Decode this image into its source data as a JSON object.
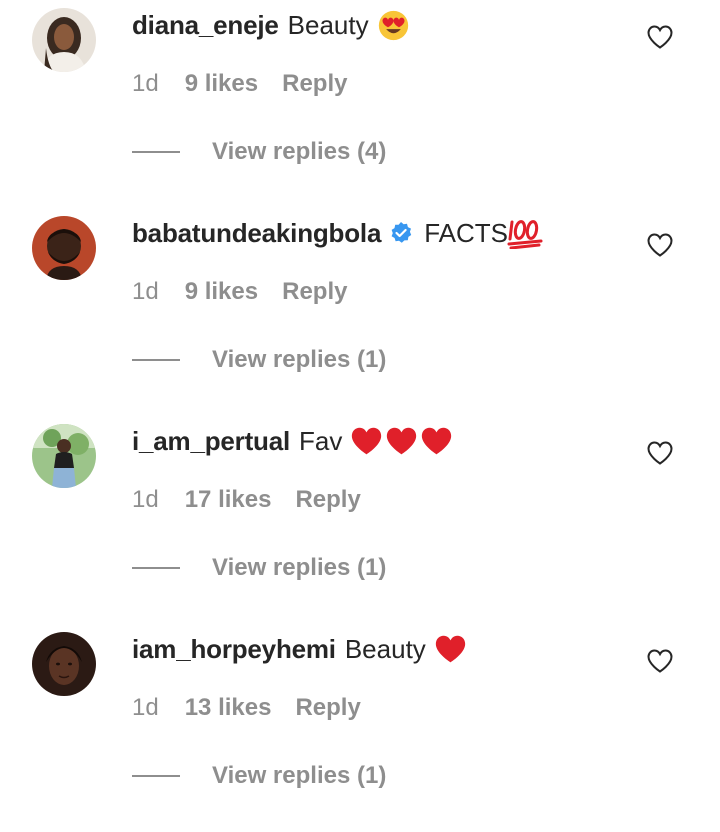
{
  "comments": [
    {
      "username": "diana_eneje",
      "verified": false,
      "text": "Beauty",
      "emojis": [
        "heart-eyes-emoji"
      ],
      "time": "1d",
      "likes": "9 likes",
      "reply": "Reply",
      "view_replies": "View replies (4)"
    },
    {
      "username": "babatundeakingbola",
      "verified": true,
      "text": "FACTS",
      "emojis": [
        "hundred-points-emoji"
      ],
      "time": "1d",
      "likes": "9 likes",
      "reply": "Reply",
      "view_replies": "View replies (1)"
    },
    {
      "username": "i_am_pertual",
      "verified": false,
      "text": "Fav",
      "emojis": [
        "red-heart-emoji",
        "red-heart-emoji",
        "red-heart-emoji"
      ],
      "time": "1d",
      "likes": "17 likes",
      "reply": "Reply",
      "view_replies": "View replies (1)"
    },
    {
      "username": "iam_horpeyhemi",
      "verified": false,
      "text": "Beauty",
      "emojis": [
        "red-heart-emoji"
      ],
      "time": "1d",
      "likes": "13 likes",
      "reply": "Reply",
      "view_replies": "View replies (1)"
    }
  ],
  "colors": {
    "primary_text": "#262626",
    "secondary_text": "#8e8e8e",
    "verified_blue": "#3897f0",
    "heart_red": "#e0202a"
  }
}
